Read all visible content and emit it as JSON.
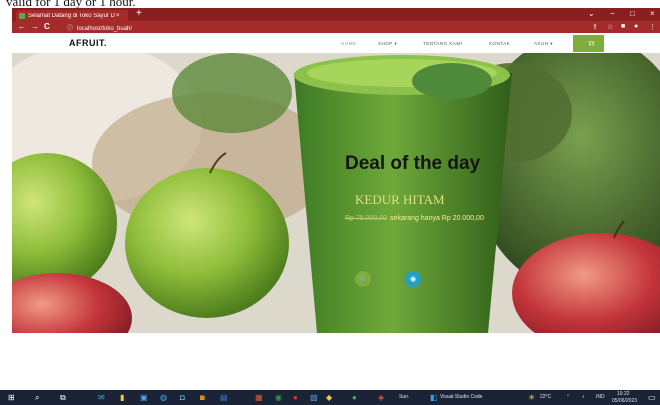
{
  "document": {
    "caption_fragment": "valid for 1 day or 1 hour."
  },
  "browser": {
    "tab_title": "Selamat Datang di Toko Sayur D",
    "new_tab": "+",
    "tab_close": "×",
    "url": "localhost/toko_buah/",
    "window_controls": {
      "chevron": "⌄",
      "minimize": "−",
      "maximize": "□",
      "close": "×"
    },
    "nav": {
      "back": "←",
      "forward": "→",
      "reload": "C",
      "info": "ⓘ"
    },
    "extensions": {
      "share": "⇪",
      "star": "☆",
      "square": "■",
      "profile": "●",
      "menu": "⋮"
    }
  },
  "site": {
    "logo": "AFRUIT.",
    "menu": {
      "home": "HOME",
      "shop": "SHOP ▾",
      "about": "TENTANG KAMI",
      "contact": "KONTAK",
      "account": "AKUN ▾"
    },
    "cart": "🛒[0]"
  },
  "hero": {
    "title": "Deal of the day",
    "product": "KEDUR HITAM",
    "old_price": "Rp 75.000,00",
    "new_price": "sekarang hanya Rp 20.000,00",
    "btn_cart_icon": "🛒",
    "btn_view_icon": "◉",
    "colors": {
      "green": "#7fad39",
      "teal": "#1fa1c9"
    }
  },
  "taskbar": {
    "app_vscode": "Visual Studio Code",
    "app_unnamed": "Sun.",
    "weather": "22°C",
    "lang": "IND",
    "time": "19.22",
    "date": "05/06/2023"
  }
}
